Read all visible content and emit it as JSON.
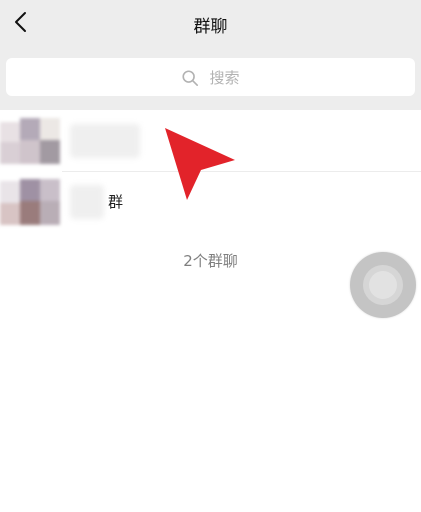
{
  "header": {
    "title": "群聊",
    "back_icon": "chevron-left-icon"
  },
  "search": {
    "placeholder": "搜索",
    "icon": "search-icon"
  },
  "groups": [
    {
      "name": "",
      "avatar": "blurred-avatar"
    },
    {
      "name": "群",
      "avatar": "blurred-avatar"
    }
  ],
  "footer": {
    "count_text": "2个群聊"
  },
  "overlay": {
    "pointer": "red-arrow-pointer",
    "assistive_touch": "assistive-touch-button"
  },
  "colors": {
    "header_bg": "#ededed",
    "pointer": "#e2232a",
    "muted_text": "#7f7f7f"
  }
}
